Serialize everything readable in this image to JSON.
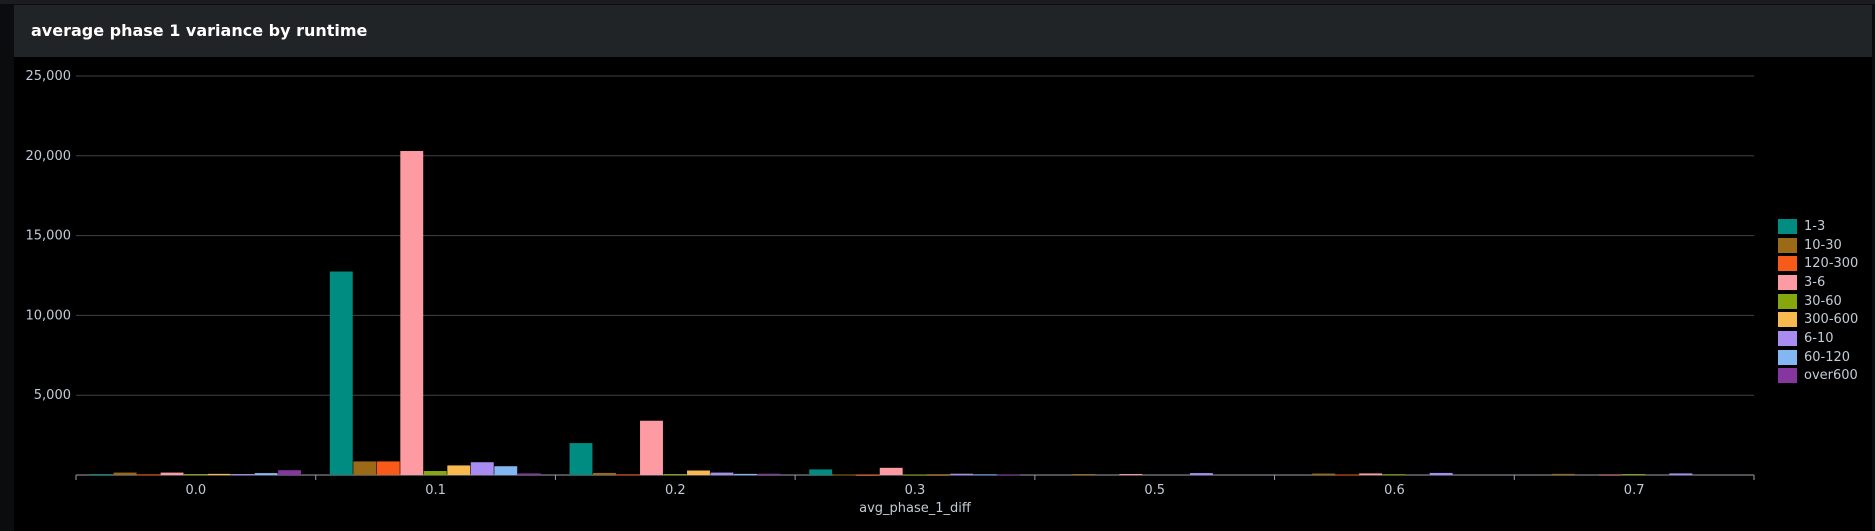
{
  "panel": {
    "title": "average phase 1 variance by runtime"
  },
  "chart_data": {
    "type": "bar",
    "title": "average phase 1 variance by runtime",
    "xlabel": "avg_phase_1_diff",
    "ylabel": "",
    "categories": [
      "0.0",
      "0.1",
      "0.2",
      "0.3",
      "0.5",
      "0.6",
      "0.7"
    ],
    "ylim": [
      0,
      25000
    ],
    "yticks": [
      "25,000",
      "20,000",
      "15,000",
      "10,000",
      "5,000"
    ],
    "grid": true,
    "legend_position": "right",
    "series": [
      {
        "name": "1-3",
        "color": "#008c80",
        "values": [
          60,
          12750,
          2000,
          350,
          0,
          0,
          0
        ]
      },
      {
        "name": "10-30",
        "color": "#9c6a16",
        "values": [
          150,
          850,
          130,
          30,
          60,
          90,
          70
        ]
      },
      {
        "name": "120-300",
        "color": "#f85a1a",
        "values": [
          40,
          850,
          40,
          10,
          0,
          30,
          0
        ]
      },
      {
        "name": "3-6",
        "color": "#fe9aa1",
        "values": [
          150,
          20300,
          3400,
          450,
          60,
          100,
          30
        ]
      },
      {
        "name": "30-60",
        "color": "#85a70d",
        "values": [
          60,
          250,
          60,
          20,
          0,
          50,
          60
        ]
      },
      {
        "name": "300-600",
        "color": "#f8b94f",
        "values": [
          70,
          600,
          280,
          30,
          0,
          0,
          0
        ]
      },
      {
        "name": "6-10",
        "color": "#a98cf2",
        "values": [
          60,
          800,
          150,
          80,
          120,
          130,
          100
        ]
      },
      {
        "name": "60-120",
        "color": "#83b7f3",
        "values": [
          120,
          550,
          70,
          40,
          0,
          0,
          0
        ]
      },
      {
        "name": "over600",
        "color": "#85369f",
        "values": [
          300,
          100,
          80,
          20,
          0,
          0,
          0
        ]
      }
    ]
  }
}
